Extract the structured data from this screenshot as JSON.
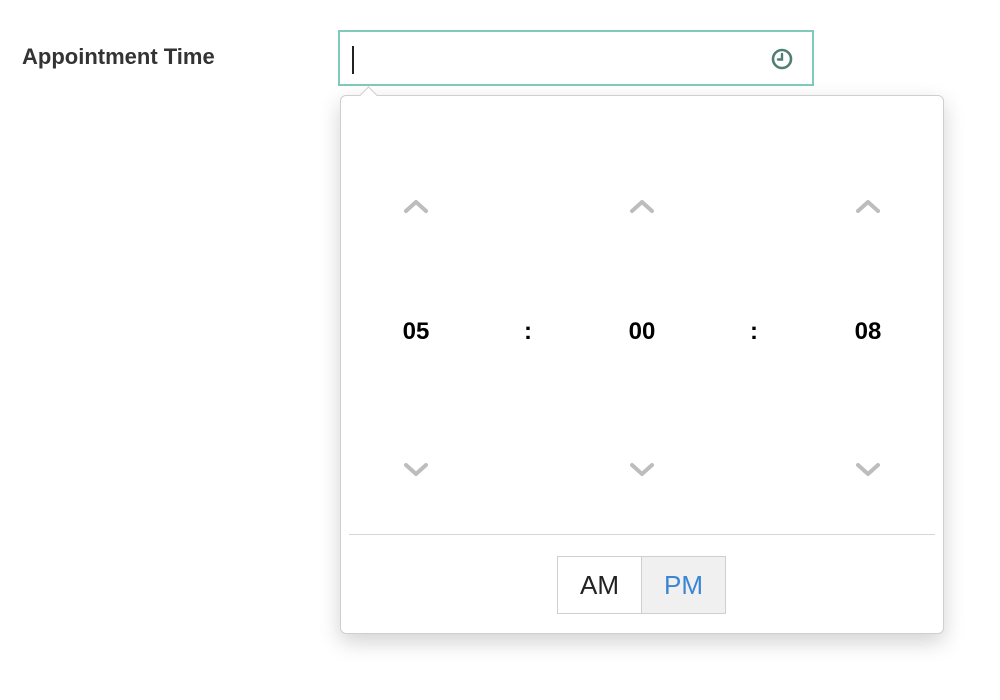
{
  "form": {
    "label": "Appointment Time",
    "input_value": "",
    "icon": "clock-icon"
  },
  "picker": {
    "hours": "05",
    "minutes": "00",
    "seconds": "08",
    "separator": ":",
    "period_options": [
      "AM",
      "PM"
    ],
    "selected_period": "PM",
    "up_icon": "chevron-up-icon",
    "down_icon": "chevron-down-icon"
  },
  "colors": {
    "input_border": "#7fcbb9",
    "clock_icon": "#4f7f72",
    "chevron": "#bdbdbd",
    "active_period_text": "#3a86d4",
    "active_period_bg": "#f0f0f0"
  }
}
